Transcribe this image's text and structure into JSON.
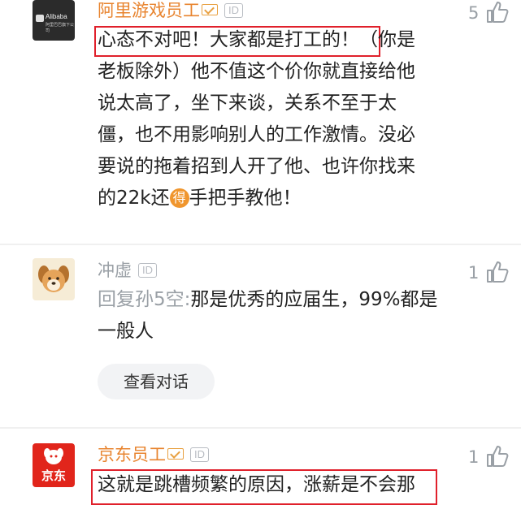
{
  "comments": [
    {
      "avatar_text": "Alibaba",
      "avatar_sub": "阿里巴巴旗下公司",
      "username": "阿里游戏员工",
      "id_badge": "ID",
      "likes": "5",
      "lines": [
        "心态不对吧！大家都是打工的！（你是",
        "老板除外）他不值这个价你就直接给他",
        "说太高了，坐下来谈，关系不至于太",
        "僵，也不用影响别人的工作激情。没必",
        "要说的拖着招到人开了他、也许你找来"
      ],
      "last_pre": "的22k还",
      "last_emoji": "得",
      "last_post": "手把手教他！"
    },
    {
      "username": "冲虚",
      "id_badge": "ID",
      "likes": "1",
      "reply_prefix": "回复孙5空:",
      "line1_rest": "那是优秀的应届生，99%都是",
      "line2": "一般人",
      "view_dialog": "查看对话"
    },
    {
      "avatar_text": "京东",
      "username": "京东员工",
      "id_badge": "ID",
      "likes": "1",
      "line1": "这就是跳槽频繁的原因，涨薪是不会那"
    }
  ],
  "colors": {
    "username": "#e8842f",
    "highlight": "#e0202b",
    "muted": "#9aa0a6"
  }
}
